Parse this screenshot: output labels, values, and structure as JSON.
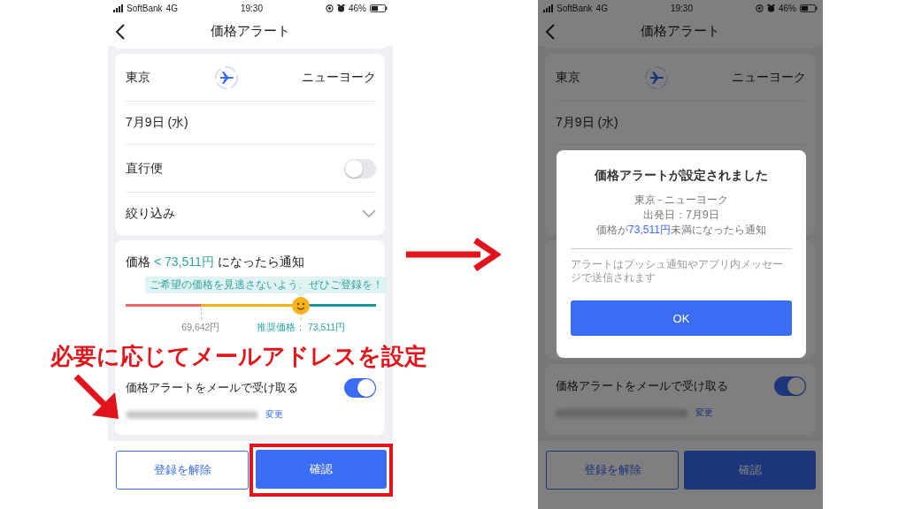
{
  "before_screen": {
    "status_bar": {
      "carrier": "SoftBank",
      "network": "4G",
      "time": "19:30",
      "battery": "46%"
    },
    "nav_title": "価格アラート",
    "route": {
      "from": "東京",
      "to": "ニューヨーク"
    },
    "date": "7月9日 (水)",
    "direct_flight": {
      "label": "直行便",
      "on": false
    },
    "filter": {
      "label": "絞り込み",
      "expanded": false
    },
    "price_alert": {
      "prefix": "価格",
      "threshold": "< 73,511円",
      "suffix": "になったら通知",
      "tip": "ご希望の価格を見逃さないよう、ぜひご登録を！",
      "level": 0.7,
      "low_price": "69,642円",
      "recommended_label": "推奨価格：",
      "recommended_price": "73,511円"
    },
    "email_alert": {
      "label": "価格アラートをメールで受け取る",
      "on": true,
      "change_link": "変更"
    },
    "buttons": [
      {
        "label": "登録を解除",
        "kind": "outline",
        "highlighted": false
      },
      {
        "label": "確認",
        "kind": "primary",
        "highlighted": true
      }
    ]
  },
  "after_screen": {
    "status_bar": {
      "carrier": "SoftBank",
      "network": "4G",
      "time": "19:30",
      "battery": "46%"
    },
    "nav_title": "価格アラート",
    "route": {
      "from": "東京",
      "to": "ニューヨーク"
    },
    "date": "7月9日 (水)",
    "email_alert": {
      "label": "価格アラートをメールで受け取る",
      "on": true,
      "change_link": "変更"
    },
    "buttons": [
      {
        "label": "登録を解除",
        "kind": "outline",
        "highlighted": false
      },
      {
        "label": "確認",
        "kind": "primary",
        "highlighted": false
      }
    ],
    "dialog": {
      "title": "価格アラートが設定されました",
      "route": "東京 - ニューヨーク",
      "departure": "出発日：7月9日",
      "condition_prefix": "価格が",
      "condition_price": "73,511円",
      "condition_suffix": "未満になったら通知",
      "note": "アラートはプッシュ通知やアプリ内メッセージで送信されます",
      "button": "OK"
    }
  },
  "annotation": {
    "text": "必要に応じてメールアドレスを設定"
  }
}
